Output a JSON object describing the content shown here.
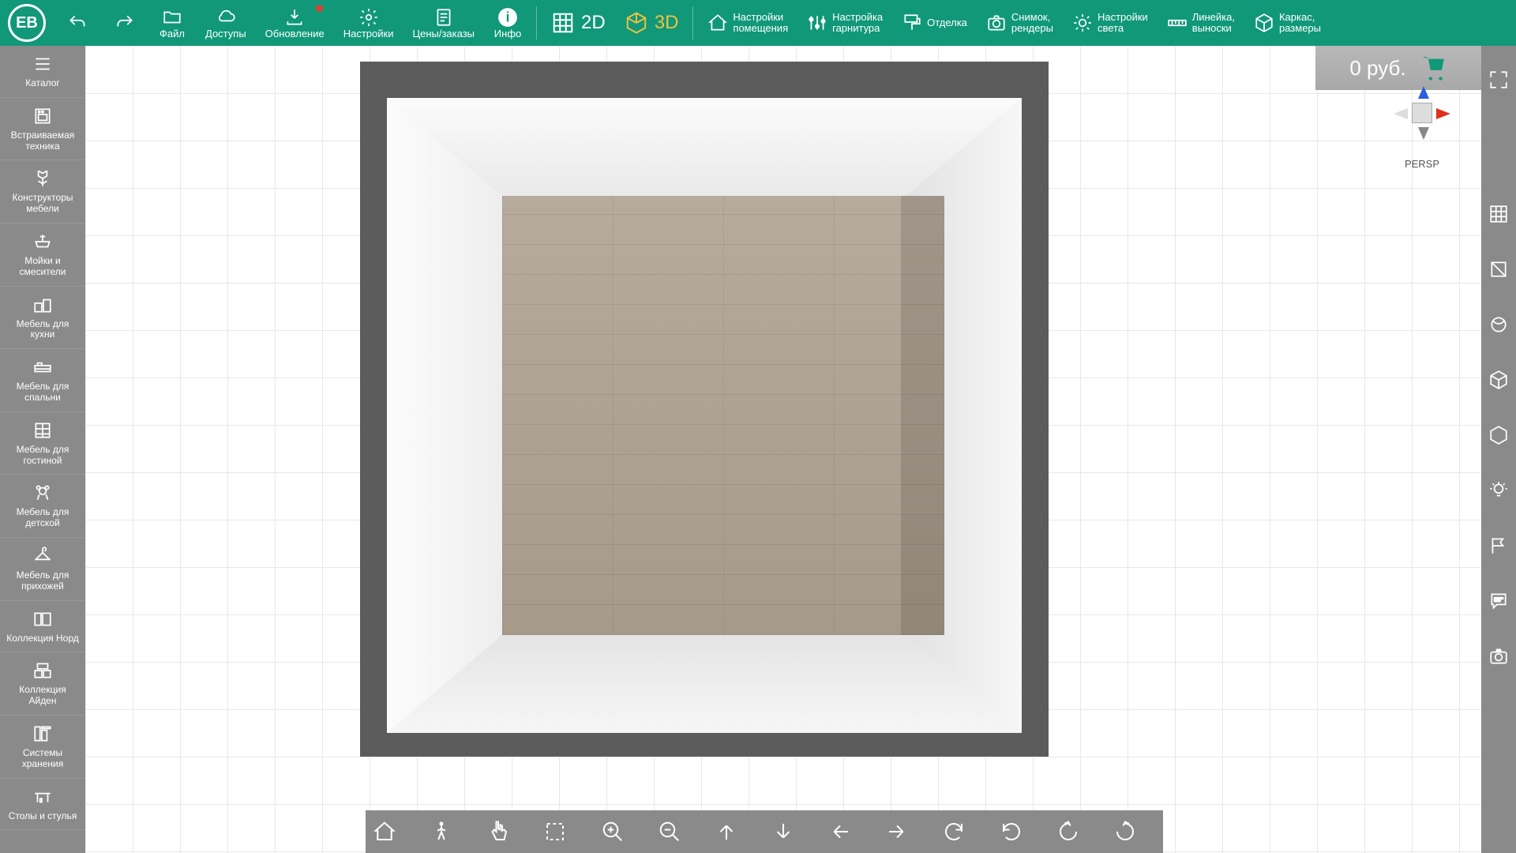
{
  "logo": "EB",
  "topbar": {
    "undo": "",
    "redo": "",
    "file": "Файл",
    "access": "Доступы",
    "update": "Обновление",
    "settings": "Настройки",
    "pricing": "Цены/заказы",
    "info": "Инфо",
    "view2d": "2D",
    "view3d": "3D",
    "room_settings_l1": "Настройки",
    "room_settings_l2": "помещения",
    "set_settings_l1": "Настройка",
    "set_settings_l2": "гарнитура",
    "finishing": "Отделка",
    "snapshot_l1": "Снимок,",
    "snapshot_l2": "рендеры",
    "light_l1": "Настройки",
    "light_l2": "света",
    "ruler_l1": "Линейка,",
    "ruler_l2": "выноски",
    "frame_l1": "Каркас,",
    "frame_l2": "размеры"
  },
  "sidebar": [
    {
      "name": "catalog",
      "label": "Каталог"
    },
    {
      "name": "appliances",
      "label": "Встраиваемая\nтехника"
    },
    {
      "name": "constructors",
      "label": "Конструкторы\nмебели"
    },
    {
      "name": "sinks",
      "label": "Мойки и\nсмесители"
    },
    {
      "name": "kitchen",
      "label": "Мебель для\nкухни"
    },
    {
      "name": "bedroom",
      "label": "Мебель для\nспальни"
    },
    {
      "name": "living",
      "label": "Мебель для\nгостиной"
    },
    {
      "name": "kids",
      "label": "Мебель для\nдетской"
    },
    {
      "name": "hallway",
      "label": "Мебель для\nприхожей"
    },
    {
      "name": "nord",
      "label": "Коллекция Норд"
    },
    {
      "name": "ayden",
      "label": "Коллекция\nАйден"
    },
    {
      "name": "storage",
      "label": "Системы\nхранения"
    },
    {
      "name": "tables",
      "label": "Столы и стулья"
    }
  ],
  "price": "0 руб.",
  "gizmo_label": "PERSP",
  "rightbar": [
    {
      "name": "fit-screen",
      "icon": "fit"
    },
    {
      "name": "grid-toggle",
      "icon": "grid"
    },
    {
      "name": "no-box",
      "icon": "nobox"
    },
    {
      "name": "material",
      "icon": "sphere"
    },
    {
      "name": "box-3d",
      "icon": "box3d"
    },
    {
      "name": "cube-solid",
      "icon": "cube"
    },
    {
      "name": "light",
      "icon": "bulb"
    },
    {
      "name": "flag",
      "icon": "flag"
    },
    {
      "name": "comments",
      "icon": "comment"
    },
    {
      "name": "camera",
      "icon": "camera"
    }
  ],
  "bottombar": [
    {
      "name": "home",
      "icon": "home"
    },
    {
      "name": "walk",
      "icon": "walk"
    },
    {
      "name": "touch",
      "icon": "touch"
    },
    {
      "name": "select-rect",
      "icon": "rect"
    },
    {
      "name": "zoom-in",
      "icon": "zoomin"
    },
    {
      "name": "zoom-out",
      "icon": "zoomout"
    },
    {
      "name": "up",
      "icon": "up"
    },
    {
      "name": "down",
      "icon": "down"
    },
    {
      "name": "left",
      "icon": "left"
    },
    {
      "name": "right",
      "icon": "right"
    },
    {
      "name": "rotate-cw",
      "icon": "rotcw"
    },
    {
      "name": "rotate-ccw",
      "icon": "rotccw"
    },
    {
      "name": "tilt-left",
      "icon": "tiltl"
    },
    {
      "name": "tilt-right",
      "icon": "tiltr"
    }
  ]
}
